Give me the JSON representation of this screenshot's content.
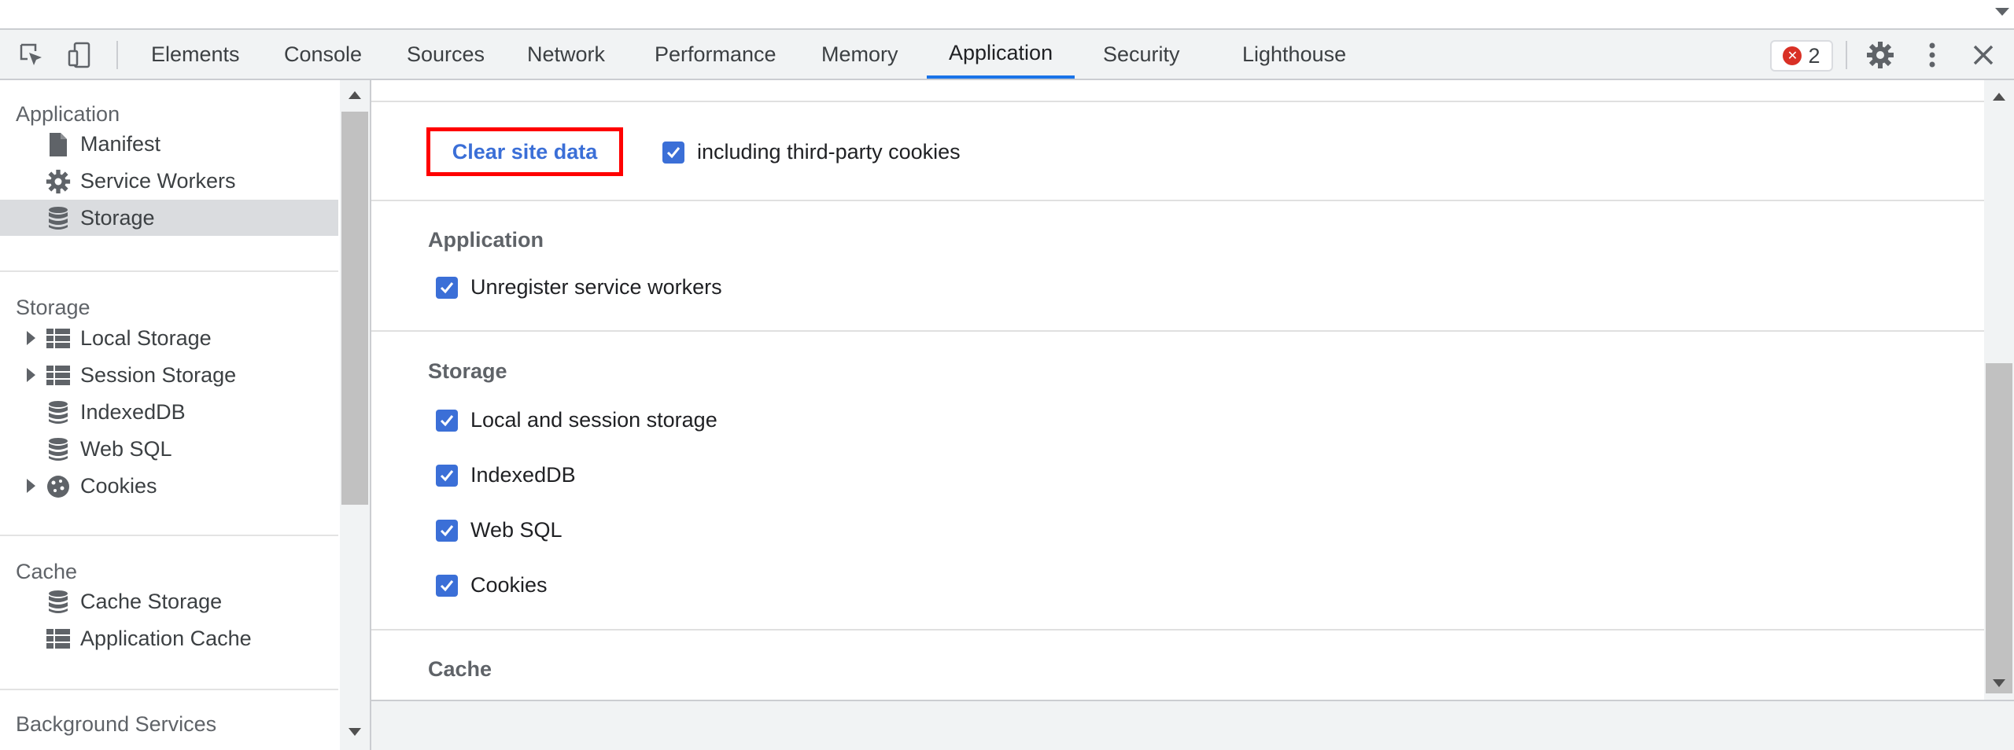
{
  "toolbar": {
    "tabs": [
      "Elements",
      "Console",
      "Sources",
      "Network",
      "Performance",
      "Memory",
      "Application",
      "Security",
      "Lighthouse"
    ],
    "active_tab": "Application",
    "error_count": "2"
  },
  "sidebar": {
    "application_heading": "Application",
    "manifest": "Manifest",
    "service_workers": "Service Workers",
    "storage_item": "Storage",
    "storage_heading": "Storage",
    "local_storage": "Local Storage",
    "session_storage": "Session Storage",
    "indexeddb": "IndexedDB",
    "web_sql": "Web SQL",
    "cookies": "Cookies",
    "cache_heading": "Cache",
    "cache_storage": "Cache Storage",
    "application_cache": "Application Cache",
    "background_heading": "Background Services"
  },
  "main": {
    "clear_button": "Clear site data",
    "third_party_label": "including third-party cookies",
    "application_heading": "Application",
    "unregister_label": "Unregister service workers",
    "storage_heading": "Storage",
    "local_session_label": "Local and session storage",
    "indexeddb_label": "IndexedDB",
    "websql_label": "Web SQL",
    "cookies_label": "Cookies",
    "cache_heading": "Cache"
  },
  "colors": {
    "accent": "#1a73e8",
    "checkbox": "#3b6fd7",
    "highlight_border": "#ff0000",
    "error": "#d93025"
  }
}
